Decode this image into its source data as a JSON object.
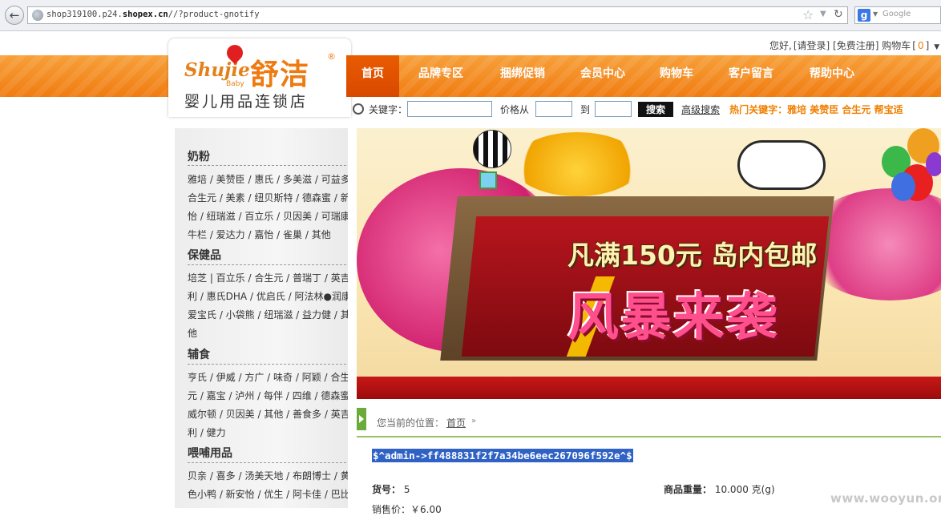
{
  "browser": {
    "url_prefix": "shop319100.p24.",
    "url_domain": "shopex.cn",
    "url_suffix": "//?product-gnotify",
    "search_engine": "Google"
  },
  "user_bar": {
    "greeting": "您好,",
    "login": "[请登录]",
    "register": "[免费注册]",
    "cart_label": "购物车",
    "cart_count_open": "[",
    "cart_count": "0",
    "cart_count_close": "]"
  },
  "logo": {
    "en": "Shujie",
    "baby": "Baby",
    "cn": "舒洁",
    "reg": "®",
    "tagline": "婴儿用品连锁店"
  },
  "nav": {
    "items": [
      {
        "label": "首页"
      },
      {
        "label": "品牌专区"
      },
      {
        "label": "捆绑促销"
      },
      {
        "label": "会员中心"
      },
      {
        "label": "购物车"
      },
      {
        "label": "客户留言"
      },
      {
        "label": "帮助中心"
      }
    ]
  },
  "search": {
    "keyword_label": "关键字：",
    "price_from_label": "价格从",
    "price_to_label": "到",
    "button": "搜索",
    "advanced": "高级搜索",
    "hot_label": "热门关键字：雅培 美赞臣 合生元 帮宝适"
  },
  "sidebar": {
    "cat1": {
      "title": "奶粉",
      "rows": [
        "雅培 / 美赞臣 / 惠氏 / 多美滋 / 可益多 /",
        "合生元 / 美素 / 纽贝斯特 / 德森蜜 / 新",
        "怡 / 纽瑞滋 / 百立乐 / 贝因美 / 可瑞康 /",
        "牛栏 / 爱达力 / 嘉怡 / 雀巢 / 其他"
      ]
    },
    "cat2": {
      "title": "保健品",
      "rows": [
        "培芝 | 百立乐 / 合生元 / 普瑞丁 / 英吉",
        "利 / 惠氏DHA / 优启氏 / 阿法林●润康 /",
        "爱宝氏 / 小袋熊 / 纽瑞滋 / 益力健 / 其",
        "他"
      ]
    },
    "cat3": {
      "title": "辅食",
      "rows": [
        "亨氏 / 伊威 / 方广 / 味奇 / 阿颖 / 合生",
        "元 / 嘉宝 / 泸州 / 每伴 / 四维 / 德森蜜 /",
        "威尔顿 / 贝因美 / 其他 / 善食多 / 英吉",
        "利 / 健力"
      ]
    },
    "cat4": {
      "title": "喂哺用品",
      "rows": [
        "贝亲 / 喜多 / 汤美天地 / 布朗博士 / 黄",
        "色小鸭 / 新安怡 / 优生 / 阿卡佳 / 巴比"
      ]
    }
  },
  "banner": {
    "line1": "凡满150元 岛内包邮",
    "line2": "风暴来袭"
  },
  "breadcrumb": {
    "label": "您当前的位置：",
    "home": "首页",
    "sep": "»"
  },
  "product": {
    "title": "$^admin->ff488831f2f7a34be6eec267096f592e^$",
    "sku_label": "货号：",
    "sku_value": "5",
    "weight_label": "商品重量：",
    "weight_value": "10.000 克(g)",
    "price_label": "销售价：￥6.00"
  },
  "watermark": "www.wooyun.org"
}
